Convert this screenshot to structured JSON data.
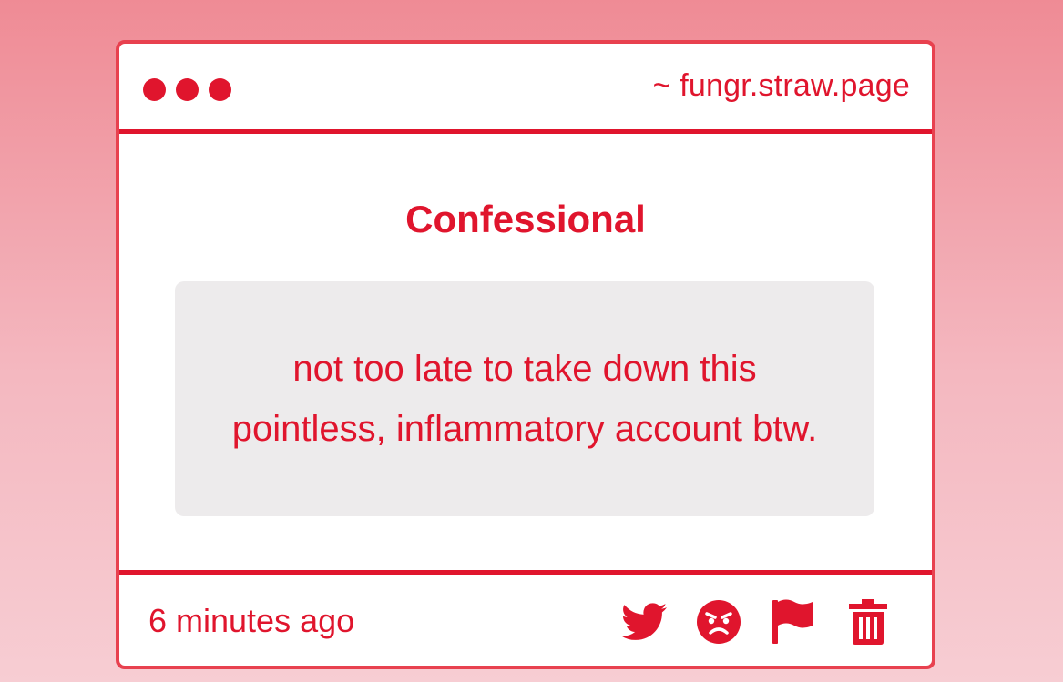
{
  "window": {
    "url": "~ fungr.straw.page",
    "controls": [
      "dot",
      "dot",
      "dot"
    ]
  },
  "main": {
    "title": "Confessional",
    "message": "not too late to take down this pointless, inflammatory account btw."
  },
  "footer": {
    "timestamp": "6 minutes ago",
    "actions": [
      {
        "name": "share-twitter",
        "icon": "twitter-bird-icon"
      },
      {
        "name": "react-angry",
        "icon": "angry-face-icon"
      },
      {
        "name": "report",
        "icon": "flag-icon"
      },
      {
        "name": "delete",
        "icon": "trash-icon"
      }
    ]
  },
  "colors": {
    "accent": "#e0152d",
    "border": "#e8414f",
    "message_bg": "#edebec",
    "background_top": "#ef8b95",
    "background_bottom": "#f7cdd3"
  }
}
